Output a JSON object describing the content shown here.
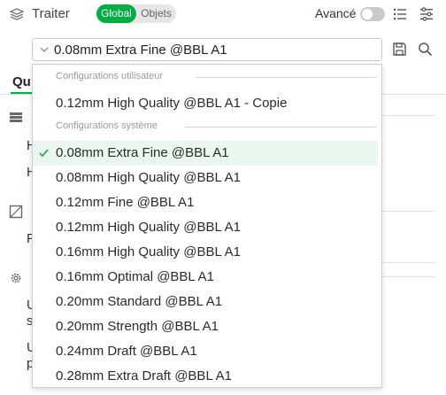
{
  "header": {
    "title": "Traiter",
    "toggle": {
      "global": "Global",
      "objets": "Objets"
    },
    "advanced_label": "Avancé",
    "advanced_on": false
  },
  "preset": {
    "current": "0.08mm Extra Fine @BBL A1"
  },
  "background": {
    "tab_stub": "Qu",
    "rows": [
      "H",
      "H",
      "P",
      "U",
      "s",
      "U",
      "p"
    ]
  },
  "dropdown": {
    "user_group_title": "Configurations utilisateur",
    "user_presets": [
      "0.12mm High Quality @BBL A1 - Copie"
    ],
    "system_group_title": "Configurations système",
    "system_presets": [
      "0.08mm Extra Fine @BBL A1",
      "0.08mm High Quality @BBL A1",
      "0.12mm Fine @BBL A1",
      "0.12mm High Quality @BBL A1",
      "0.16mm High Quality @BBL A1",
      "0.16mm Optimal @BBL A1",
      "0.20mm Standard @BBL A1",
      "0.20mm Strength @BBL A1",
      "0.24mm Draft @BBL A1",
      "0.28mm Extra Draft @BBL A1"
    ],
    "selected_index": 0
  },
  "colors": {
    "accent": "#00ae42",
    "selected_bg": "#eaf7ee"
  },
  "icons": [
    "layers-icon",
    "list-icon",
    "params-icon",
    "chevron-down-icon",
    "save-icon",
    "search-icon",
    "check-icon",
    "layers-section-icon",
    "wall-section-icon",
    "gear-section-icon"
  ]
}
